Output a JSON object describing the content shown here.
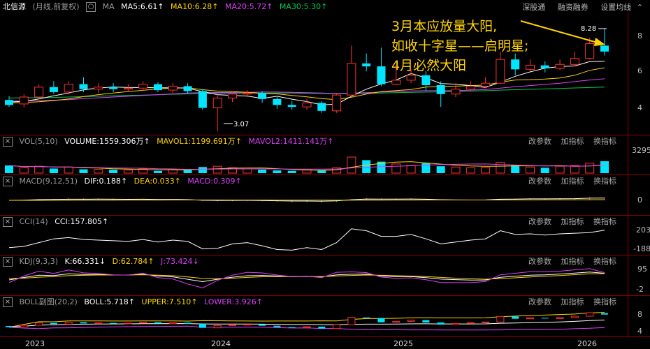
{
  "header": {
    "stock_name": "北信源",
    "period": "(月线,前复权)",
    "ma_label": "MA",
    "ma5": "MA5:6.61",
    "ma10": "MA10:6.28",
    "ma20": "MA20:5.72",
    "ma30": "MA30:5.30",
    "buttons": [
      "深股通",
      "融资融券",
      "设置均线"
    ]
  },
  "annotation": [
    "3月本应放量大阳,",
    "如收十字星——启明星;",
    "4月必然大阳"
  ],
  "price_labels": {
    "high": "8.28",
    "low": "3.07",
    "axis": [
      "8",
      "6",
      "4"
    ]
  },
  "panels": {
    "vol": {
      "title": "VOL(5,10)",
      "v1": "VOLUME:1559.306万",
      "v2": "MAVOL1:1199.691万",
      "v3": "MAVOL2:1411.141万",
      "axis": "3295"
    },
    "macd": {
      "title": "MACD(9,12,51)",
      "v1": "DIF:0.188",
      "v2": "DEA:0.033",
      "v3": "MACD:0.309",
      "axis": "0"
    },
    "cci": {
      "title": "CCI(14)",
      "v1": "CCI:157.805",
      "axis": [
        "203",
        "-188"
      ]
    },
    "kdj": {
      "title": "KDJ(9,3,3)",
      "v1": "K:66.331",
      "v2": "D:62.784",
      "v3": "J:73.424",
      "axis": [
        "95",
        "-2"
      ]
    },
    "boll": {
      "title": "BOLL副图(20,2)",
      "v1": "BOLL:5.718",
      "v2": "UPPER:7.510",
      "v3": "LOWER:3.926",
      "axis": [
        "8",
        "4"
      ]
    }
  },
  "panel_buttons": [
    "改参数",
    "加指标",
    "换指标"
  ],
  "x_axis": [
    "2023",
    "2024",
    "2025",
    "2026"
  ],
  "colors": {
    "up": "#ff3232",
    "down": "#00e5ff",
    "ma5": "#ffffff",
    "ma10": "#ffd400",
    "ma20": "#e040fb",
    "ma30": "#00c853",
    "annotation": "#ffd400"
  },
  "chart_data": {
    "type": "candlestick",
    "price_axis": [
      3.0,
      9.0
    ],
    "candles": [
      [
        4.65,
        4.4,
        4.85,
        4.3
      ],
      [
        4.45,
        4.8,
        4.95,
        4.3
      ],
      [
        4.8,
        5.3,
        5.45,
        4.7
      ],
      [
        5.3,
        5.05,
        5.6,
        4.95
      ],
      [
        5.05,
        5.45,
        5.6,
        4.95
      ],
      [
        5.45,
        5.2,
        5.8,
        5.05
      ],
      [
        5.2,
        5.3,
        5.5,
        5.0
      ],
      [
        5.3,
        5.2,
        5.5,
        5.05
      ],
      [
        5.2,
        5.25,
        5.45,
        5.05
      ],
      [
        5.25,
        5.45,
        5.6,
        5.1
      ],
      [
        5.45,
        5.15,
        5.55,
        5.05
      ],
      [
        5.15,
        5.35,
        5.5,
        5.0
      ],
      [
        5.35,
        5.1,
        5.5,
        4.95
      ],
      [
        5.1,
        4.25,
        5.2,
        4.15
      ],
      [
        4.25,
        4.75,
        4.95,
        3.07
      ],
      [
        4.75,
        4.95,
        5.1,
        4.55
      ],
      [
        4.95,
        5.0,
        5.15,
        4.8
      ],
      [
        5.0,
        4.7,
        5.1,
        4.5
      ],
      [
        4.7,
        4.4,
        4.8,
        4.2
      ],
      [
        4.4,
        4.3,
        4.6,
        4.15
      ],
      [
        4.3,
        4.5,
        4.7,
        4.15
      ],
      [
        4.5,
        4.1,
        4.6,
        4.0
      ],
      [
        4.1,
        4.9,
        5.0,
        4.0
      ],
      [
        4.9,
        6.5,
        7.4,
        4.8
      ],
      [
        6.5,
        6.35,
        7.0,
        6.1
      ],
      [
        6.35,
        5.45,
        7.3,
        5.35
      ],
      [
        5.45,
        5.65,
        6.4,
        5.4
      ],
      [
        5.65,
        5.9,
        6.2,
        5.5
      ],
      [
        5.9,
        5.4,
        6.1,
        5.1
      ],
      [
        5.4,
        4.95,
        5.6,
        4.3
      ],
      [
        4.95,
        5.2,
        5.5,
        4.8
      ],
      [
        5.2,
        5.35,
        5.6,
        5.1
      ],
      [
        5.35,
        5.5,
        5.8,
        5.25
      ],
      [
        5.5,
        6.7,
        7.1,
        5.45
      ],
      [
        6.7,
        6.2,
        7.0,
        5.9
      ],
      [
        6.2,
        6.4,
        6.7,
        6.1
      ],
      [
        6.4,
        6.25,
        6.6,
        6.05
      ],
      [
        6.25,
        6.45,
        6.7,
        6.15
      ],
      [
        6.45,
        6.75,
        7.1,
        6.35
      ],
      [
        6.75,
        7.5,
        7.8,
        6.7
      ],
      [
        7.4,
        7.1,
        8.28,
        6.9
      ]
    ],
    "ma5": [
      4.55,
      4.58,
      4.7,
      4.86,
      5.0,
      5.16,
      5.26,
      5.31,
      5.28,
      5.28,
      5.27,
      5.27,
      5.25,
      5.07,
      4.92,
      4.88,
      4.85,
      4.73,
      4.84,
      4.69,
      4.57,
      4.4,
      4.44,
      4.84,
      5.2,
      5.46,
      5.66,
      5.99,
      5.77,
      5.48,
      5.45,
      5.38,
      5.28,
      5.55,
      5.85,
      6.07,
      6.26,
      6.34,
      6.37,
      6.59,
      6.61
    ],
    "ma10": [
      4.5,
      4.52,
      4.56,
      4.62,
      4.7,
      4.82,
      4.92,
      5.0,
      5.08,
      5.14,
      5.21,
      5.25,
      5.27,
      5.17,
      5.1,
      5.07,
      5.04,
      4.98,
      4.96,
      4.88,
      4.81,
      4.72,
      4.67,
      4.79,
      4.95,
      5.07,
      5.13,
      5.18,
      5.3,
      5.34,
      5.35,
      5.38,
      5.4,
      5.55,
      5.66,
      5.68,
      5.71,
      5.76,
      5.9,
      6.15,
      6.28
    ],
    "ma20": [
      4.6,
      4.6,
      4.62,
      4.64,
      4.67,
      4.72,
      4.76,
      4.8,
      4.84,
      4.88,
      4.92,
      4.96,
      5.0,
      5.02,
      5.03,
      5.03,
      5.04,
      5.05,
      5.05,
      5.04,
      5.02,
      5.0,
      4.98,
      5.0,
      5.02,
      5.05,
      5.08,
      5.11,
      5.12,
      5.12,
      5.13,
      5.15,
      5.18,
      5.25,
      5.32,
      5.38,
      5.44,
      5.5,
      5.58,
      5.66,
      5.72
    ],
    "ma30": [
      4.75,
      4.76,
      4.77,
      4.78,
      4.8,
      4.82,
      4.84,
      4.86,
      4.88,
      4.9,
      4.92,
      4.94,
      4.96,
      4.97,
      4.98,
      4.99,
      5.0,
      5.0,
      5.0,
      5.0,
      4.99,
      4.98,
      4.97,
      4.98,
      4.99,
      5.0,
      5.02,
      5.04,
      5.05,
      5.06,
      5.08,
      5.1,
      5.12,
      5.15,
      5.17,
      5.19,
      5.21,
      5.23,
      5.26,
      5.28,
      5.3
    ],
    "volume_wan": [
      1000,
      700,
      900,
      600,
      800,
      500,
      500,
      450,
      400,
      550,
      300,
      450,
      400,
      800,
      900,
      700,
      550,
      450,
      350,
      300,
      400,
      350,
      700,
      2100,
      1700,
      1500,
      1200,
      1000,
      1300,
      900,
      800,
      700,
      750,
      1400,
      1100,
      800,
      700,
      900,
      1000,
      1300,
      1559
    ],
    "cci": [
      -120,
      -100,
      -40,
      20,
      40,
      10,
      0,
      -10,
      -20,
      10,
      -30,
      0,
      -20,
      -140,
      -130,
      -60,
      -40,
      -90,
      -150,
      -160,
      -120,
      -150,
      -40,
      180,
      150,
      60,
      60,
      90,
      20,
      -60,
      -30,
      0,
      20,
      150,
      90,
      100,
      80,
      100,
      110,
      120,
      158
    ]
  }
}
